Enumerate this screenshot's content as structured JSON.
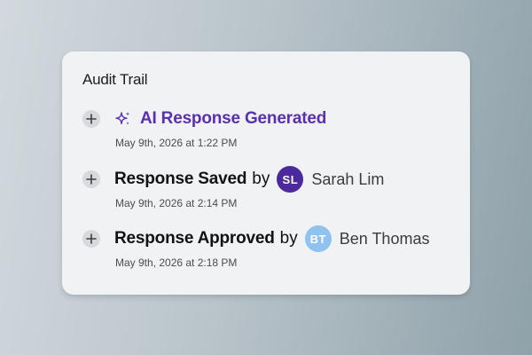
{
  "audit_trail": {
    "title": "Audit Trail",
    "entries": [
      {
        "action": "AI Response Generated",
        "timestamp": "May 9th, 2026 at 1:22 PM",
        "icon": "sparkle-icon",
        "accent_color": "#5a2fb0"
      },
      {
        "action": "Response Saved",
        "by": "by",
        "user": {
          "initials": "SL",
          "name": "Sarah Lim",
          "avatar_color": "#4c2a9e"
        },
        "timestamp": "May 9th, 2026 at 2:14 PM"
      },
      {
        "action": "Response Approved",
        "by": "by",
        "user": {
          "initials": "BT",
          "name": "Ben Thomas",
          "avatar_color": "#8fc2ee"
        },
        "timestamp": "May 9th, 2026 at 2:18 PM"
      }
    ]
  }
}
